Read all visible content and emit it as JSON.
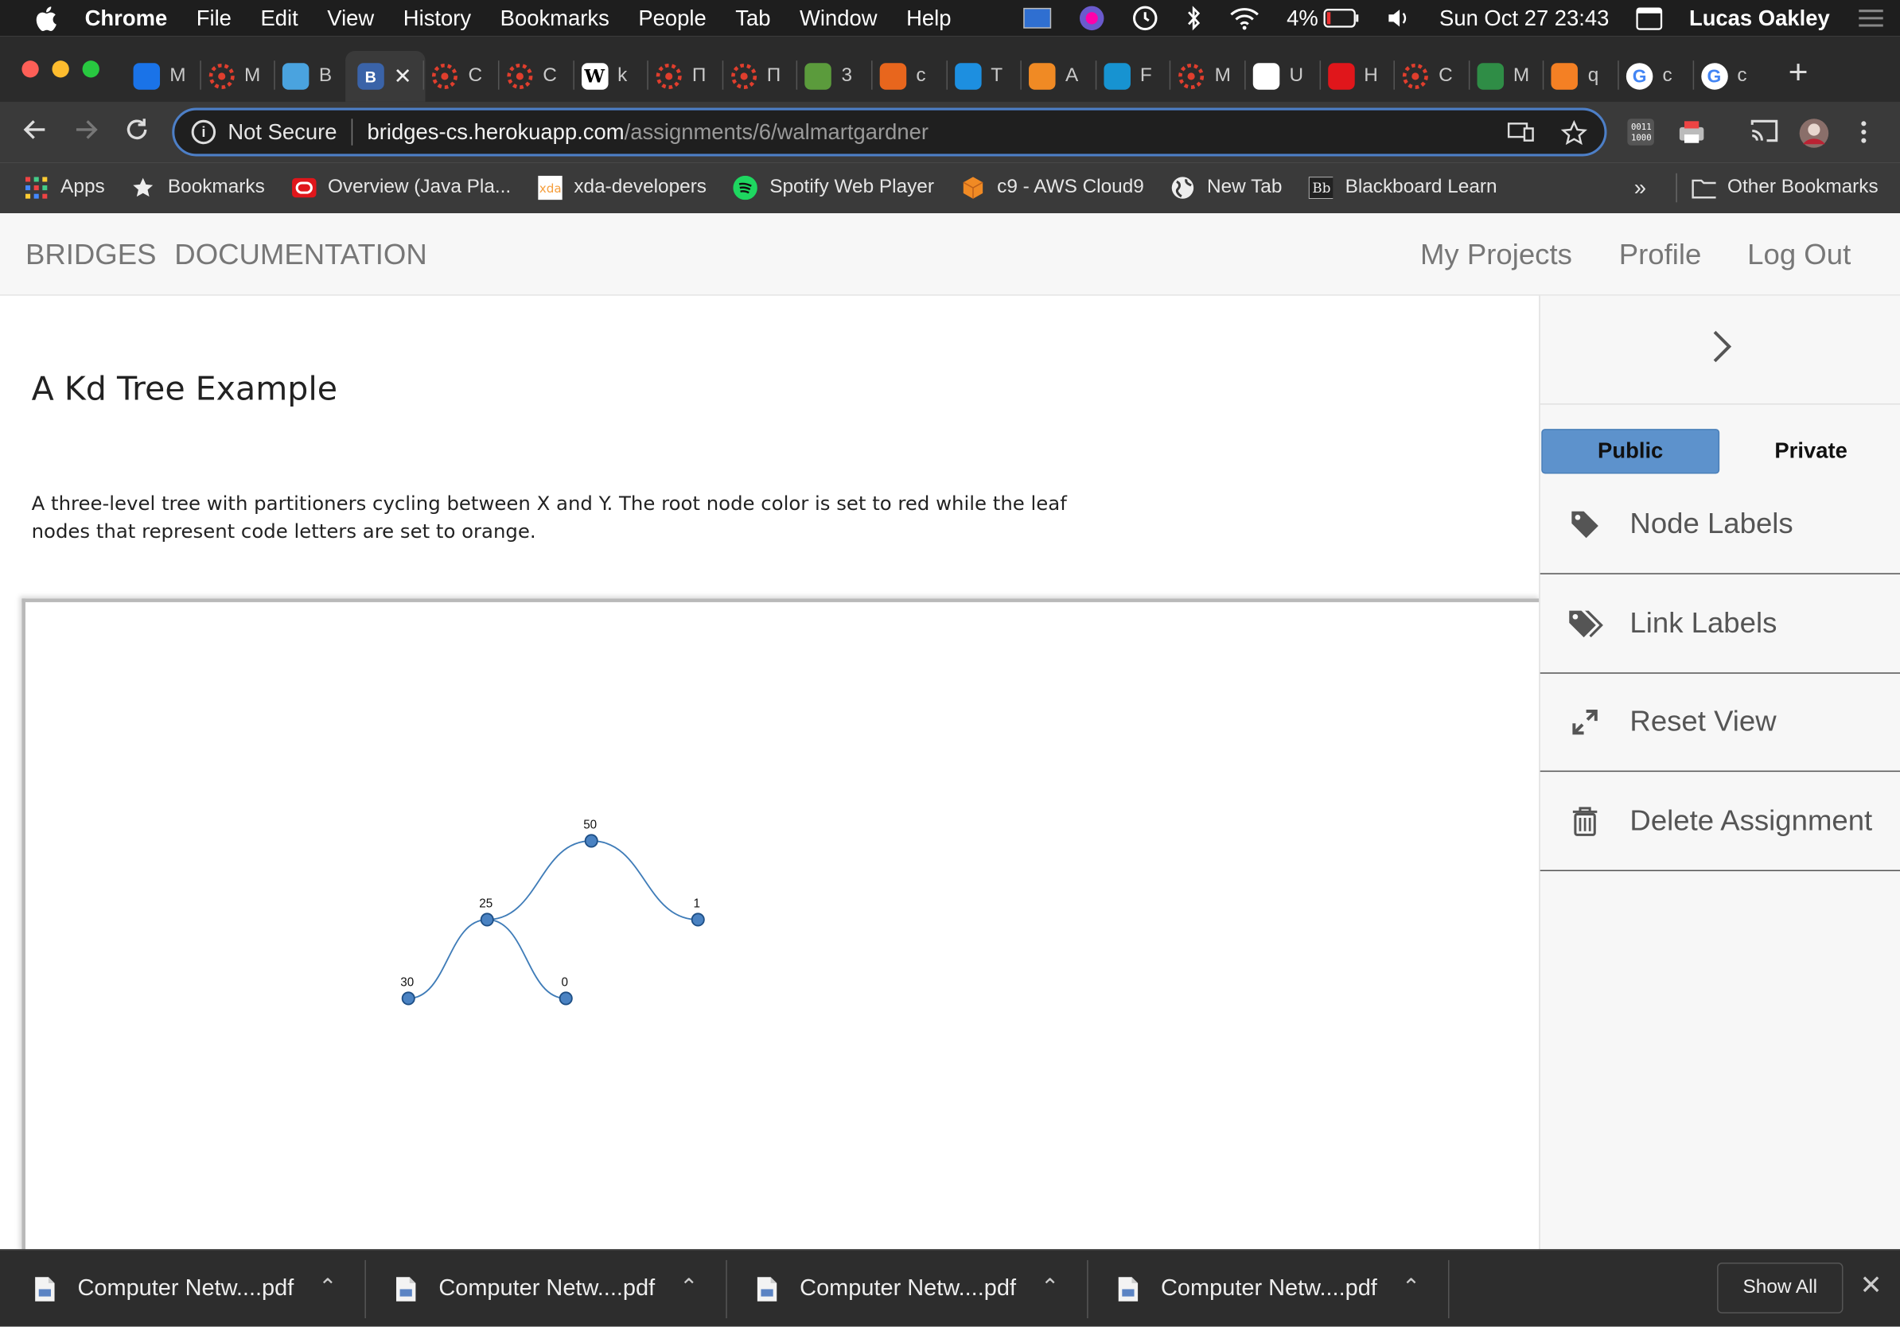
{
  "menubar": {
    "app": "Chrome",
    "items": [
      "File",
      "Edit",
      "View",
      "History",
      "Bookmarks",
      "People",
      "Tab",
      "Window",
      "Help"
    ],
    "battery": "4%",
    "datetime": "Sun Oct 27  23:43",
    "user": "Lucas Oakley"
  },
  "tabs": [
    {
      "letter": "M",
      "icon": "meet-icon",
      "color": "#1a73e8"
    },
    {
      "letter": "M",
      "icon": "canvas-icon",
      "color": "#e03e2d"
    },
    {
      "letter": "B",
      "icon": "bitmoji-icon",
      "color": "#4aa3df"
    },
    {
      "letter": "B",
      "icon": "bridges-icon",
      "color": "#3a63a8",
      "active": true
    },
    {
      "letter": "C",
      "icon": "canvas-icon",
      "color": "#e03e2d"
    },
    {
      "letter": "C",
      "icon": "canvas-icon",
      "color": "#e03e2d"
    },
    {
      "letter": "k",
      "icon": "wikipedia-icon",
      "color": "#ffffff"
    },
    {
      "letter": "П",
      "icon": "canvas-icon",
      "color": "#e03e2d"
    },
    {
      "letter": "П",
      "icon": "canvas-icon",
      "color": "#e03e2d"
    },
    {
      "letter": "3",
      "icon": "wh-icon",
      "color": "#5b9b3c"
    },
    {
      "letter": "c",
      "icon": "gear-orange-icon",
      "color": "#e8661d"
    },
    {
      "letter": "T",
      "icon": "bird-icon",
      "color": "#1d8fe0"
    },
    {
      "letter": "A",
      "icon": "aws-cube-icon",
      "color": "#f08a24"
    },
    {
      "letter": "F",
      "icon": "arch-icon",
      "color": "#1793d1"
    },
    {
      "letter": "M",
      "icon": "canvas-icon",
      "color": "#e03e2d"
    },
    {
      "letter": "U",
      "icon": "diamond-icon",
      "color": "#ffffff"
    },
    {
      "letter": "H",
      "icon": "oracle-icon",
      "color": "#e0161b"
    },
    {
      "letter": "C",
      "icon": "canvas-icon",
      "color": "#e03e2d"
    },
    {
      "letter": "M",
      "icon": "gfg-icon",
      "color": "#2f8d46"
    },
    {
      "letter": "q",
      "icon": "stackoverflow-icon",
      "color": "#f48024"
    },
    {
      "letter": "c",
      "icon": "google-icon",
      "color": "#ffffff"
    },
    {
      "letter": "c",
      "icon": "google-icon",
      "color": "#ffffff"
    }
  ],
  "omnibox": {
    "security": "Not Secure",
    "host": "bridges-cs.herokuapp.com",
    "path": "/assignments/6/walmartgardner"
  },
  "bookmarks": [
    "Apps",
    "Bookmarks",
    "Overview (Java Pla...",
    "xda-developers",
    "Spotify Web Player",
    "c9 - AWS Cloud9",
    "New Tab",
    "Blackboard Learn"
  ],
  "bookmarks_overflow": "»",
  "other_bookmarks": "Other Bookmarks",
  "nav": {
    "brand": "BRIDGES",
    "documentation": "DOCUMENTATION",
    "my_projects": "My Projects",
    "profile": "Profile",
    "logout": "Log Out"
  },
  "assignment": {
    "title": "A Kd Tree Example",
    "description": "A three-level tree with partitioners cycling between X and Y. The root node color is set to red while the leaf nodes that represent code letters are set to orange."
  },
  "tree": {
    "node_color": "#4a82c2",
    "link_color": "#3f7cb8",
    "nodes": [
      {
        "id": "n50",
        "label": "50"
      },
      {
        "id": "n25",
        "label": "25"
      },
      {
        "id": "n1",
        "label": "1"
      },
      {
        "id": "n30",
        "label": "30"
      },
      {
        "id": "n0",
        "label": "0"
      }
    ],
    "links": [
      [
        "n50",
        "n25"
      ],
      [
        "n50",
        "n1"
      ],
      [
        "n25",
        "n30"
      ],
      [
        "n25",
        "n0"
      ]
    ]
  },
  "sidebar": {
    "public": "Public",
    "private": "Private",
    "items": [
      {
        "label": "Node Labels",
        "icon": "tag-icon"
      },
      {
        "label": "Link Labels",
        "icon": "tags-icon"
      },
      {
        "label": "Reset View",
        "icon": "expand-icon"
      },
      {
        "label": "Delete Assignment",
        "icon": "trash-icon"
      }
    ]
  },
  "downloads": {
    "files": [
      "Computer Netw....pdf",
      "Computer Netw....pdf",
      "Computer Netw....pdf",
      "Computer Netw....pdf"
    ],
    "show_all": "Show All"
  }
}
